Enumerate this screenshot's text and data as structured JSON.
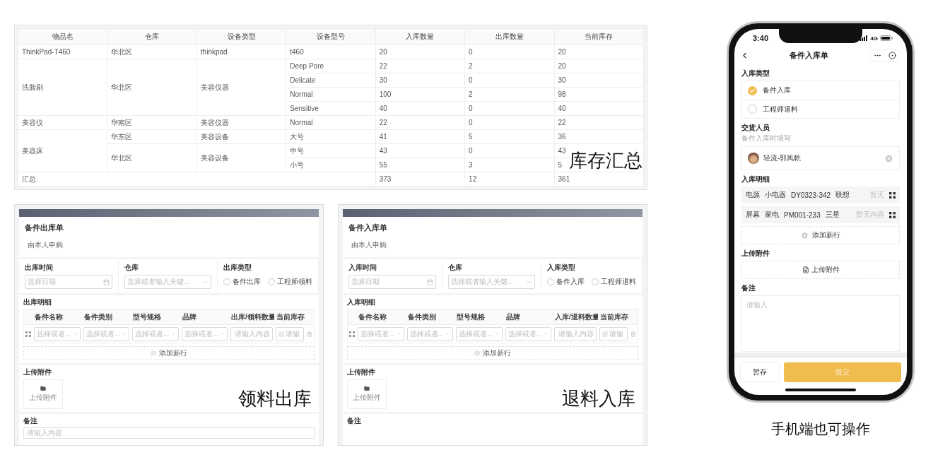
{
  "summary_table": {
    "columns": [
      "物品名",
      "仓库",
      "设备类型",
      "设备型号",
      "入库数量",
      "出库数量",
      "当前库存"
    ],
    "items": [
      {
        "name": "ThinkPad-T460",
        "groups": [
          {
            "warehouse": "华北区",
            "type": "thinkpad",
            "models": [
              {
                "model": "t460",
                "in": "20",
                "out": "0",
                "stock": "20"
              }
            ]
          }
        ]
      },
      {
        "name": "洗脸刷",
        "groups": [
          {
            "warehouse": "华北区",
            "type": "美容仪器",
            "models": [
              {
                "model": "Deep Pore",
                "in": "22",
                "out": "2",
                "stock": "20"
              },
              {
                "model": "Delicate",
                "in": "30",
                "out": "0",
                "stock": "30"
              },
              {
                "model": "Normal",
                "in": "100",
                "out": "2",
                "stock": "98"
              },
              {
                "model": "Sensitive",
                "in": "40",
                "out": "0",
                "stock": "40"
              }
            ]
          }
        ]
      },
      {
        "name": "美容仪",
        "groups": [
          {
            "warehouse": "华南区",
            "type": "美容仪器",
            "models": [
              {
                "model": "Normal",
                "in": "22",
                "out": "0",
                "stock": "22"
              }
            ]
          }
        ]
      },
      {
        "name": "美容床",
        "groups": [
          {
            "warehouse": "华东区",
            "type": "美容设备",
            "models": [
              {
                "model": "大号",
                "in": "41",
                "out": "5",
                "stock": "36"
              }
            ]
          },
          {
            "warehouse": "华北区",
            "type": "美容设备",
            "models": [
              {
                "model": "中号",
                "in": "43",
                "out": "0",
                "stock": "43"
              },
              {
                "model": "小号",
                "in": "55",
                "out": "3",
                "stock": "5"
              }
            ]
          }
        ]
      }
    ],
    "total": {
      "label": "汇总",
      "in": "373",
      "out": "12",
      "stock": "361"
    },
    "caption": "库存汇总"
  },
  "forms": [
    {
      "title": "备件出库单",
      "applicant": "由本人申购",
      "fields": [
        {
          "kind": "date",
          "label": "出库时间",
          "placeholder": "选择日期"
        },
        {
          "kind": "select",
          "label": "仓库",
          "placeholder": "选择或者输入关键..."
        },
        {
          "kind": "radio",
          "label": "出库类型",
          "options": [
            {
              "label": "备件出库",
              "selected": false
            },
            {
              "label": "工程师领料",
              "selected": false
            }
          ]
        }
      ],
      "detail": {
        "label": "出库明细",
        "columns": [
          "备件名称",
          "备件类别",
          "型号规格",
          "品牌",
          "出库/领料数量",
          "当前库存"
        ],
        "cells": [
          {
            "kind": "select",
            "placeholder": "选择或者..."
          },
          {
            "kind": "select",
            "placeholder": "选择或者..."
          },
          {
            "kind": "select",
            "placeholder": "选择或者..."
          },
          {
            "kind": "select",
            "placeholder": "选择或者..."
          },
          {
            "kind": "input",
            "placeholder": "请输入内容"
          },
          {
            "kind": "input",
            "placeholder": "请输"
          }
        ],
        "add_row": "添加新行"
      },
      "upload": {
        "label": "上传附件",
        "button": "上传附件"
      },
      "remark": {
        "label": "备注",
        "placeholder": "请输入内容"
      },
      "caption": "领料出库"
    },
    {
      "title": "备件入库单",
      "applicant": "由本人申购",
      "fields": [
        {
          "kind": "date",
          "label": "入库时间",
          "placeholder": "选择日期"
        },
        {
          "kind": "select",
          "label": "仓库",
          "placeholder": "选择或者输入关键..."
        },
        {
          "kind": "radio",
          "label": "入库类型",
          "options": [
            {
              "label": "备件入库",
              "selected": false
            },
            {
              "label": "工程师退料",
              "selected": false
            }
          ]
        }
      ],
      "detail": {
        "label": "入库明细",
        "columns": [
          "备件名称",
          "备件类别",
          "型号规格",
          "品牌",
          "入库/退料数量",
          "当前库存"
        ],
        "cells": [
          {
            "kind": "select",
            "placeholder": "选择或者..."
          },
          {
            "kind": "select",
            "placeholder": "选择或者..."
          },
          {
            "kind": "select",
            "placeholder": "选择或者..."
          },
          {
            "kind": "select",
            "placeholder": "选择或者..."
          },
          {
            "kind": "input",
            "placeholder": "请输入内容"
          },
          {
            "kind": "input",
            "placeholder": "请输"
          }
        ],
        "add_row": "添加新行"
      },
      "upload": {
        "label": "上传附件",
        "button": "上传附件"
      },
      "remark": {
        "label": "备注"
      },
      "caption": "退料入库"
    }
  ],
  "phone": {
    "status": {
      "time": "3:40",
      "network": "4G"
    },
    "title": "备件入库单",
    "entry_type": {
      "label": "入库类型",
      "options": [
        {
          "label": "备件入库",
          "selected": true
        },
        {
          "label": "工程师退料",
          "selected": false
        }
      ]
    },
    "deliverer": {
      "label": "交货人员",
      "hint": "备件入库时填写",
      "person": "轻流-郭凤乾"
    },
    "detail": {
      "label": "入库明细",
      "rows": [
        {
          "cells": [
            "电源",
            "小电器",
            "DY0323-342",
            "联想"
          ],
          "note": "暂无"
        },
        {
          "cells": [
            "屏幕",
            "家电",
            "PM001-233",
            "三星"
          ],
          "note": "暂无内容"
        }
      ],
      "add_row": "添加新行"
    },
    "upload": {
      "label": "上传附件",
      "button": "上传附件"
    },
    "remark": {
      "label": "备注",
      "placeholder": "请输入"
    },
    "buttons": {
      "save": "暂存",
      "submit": "提交"
    },
    "caption": "手机端也可操作"
  }
}
